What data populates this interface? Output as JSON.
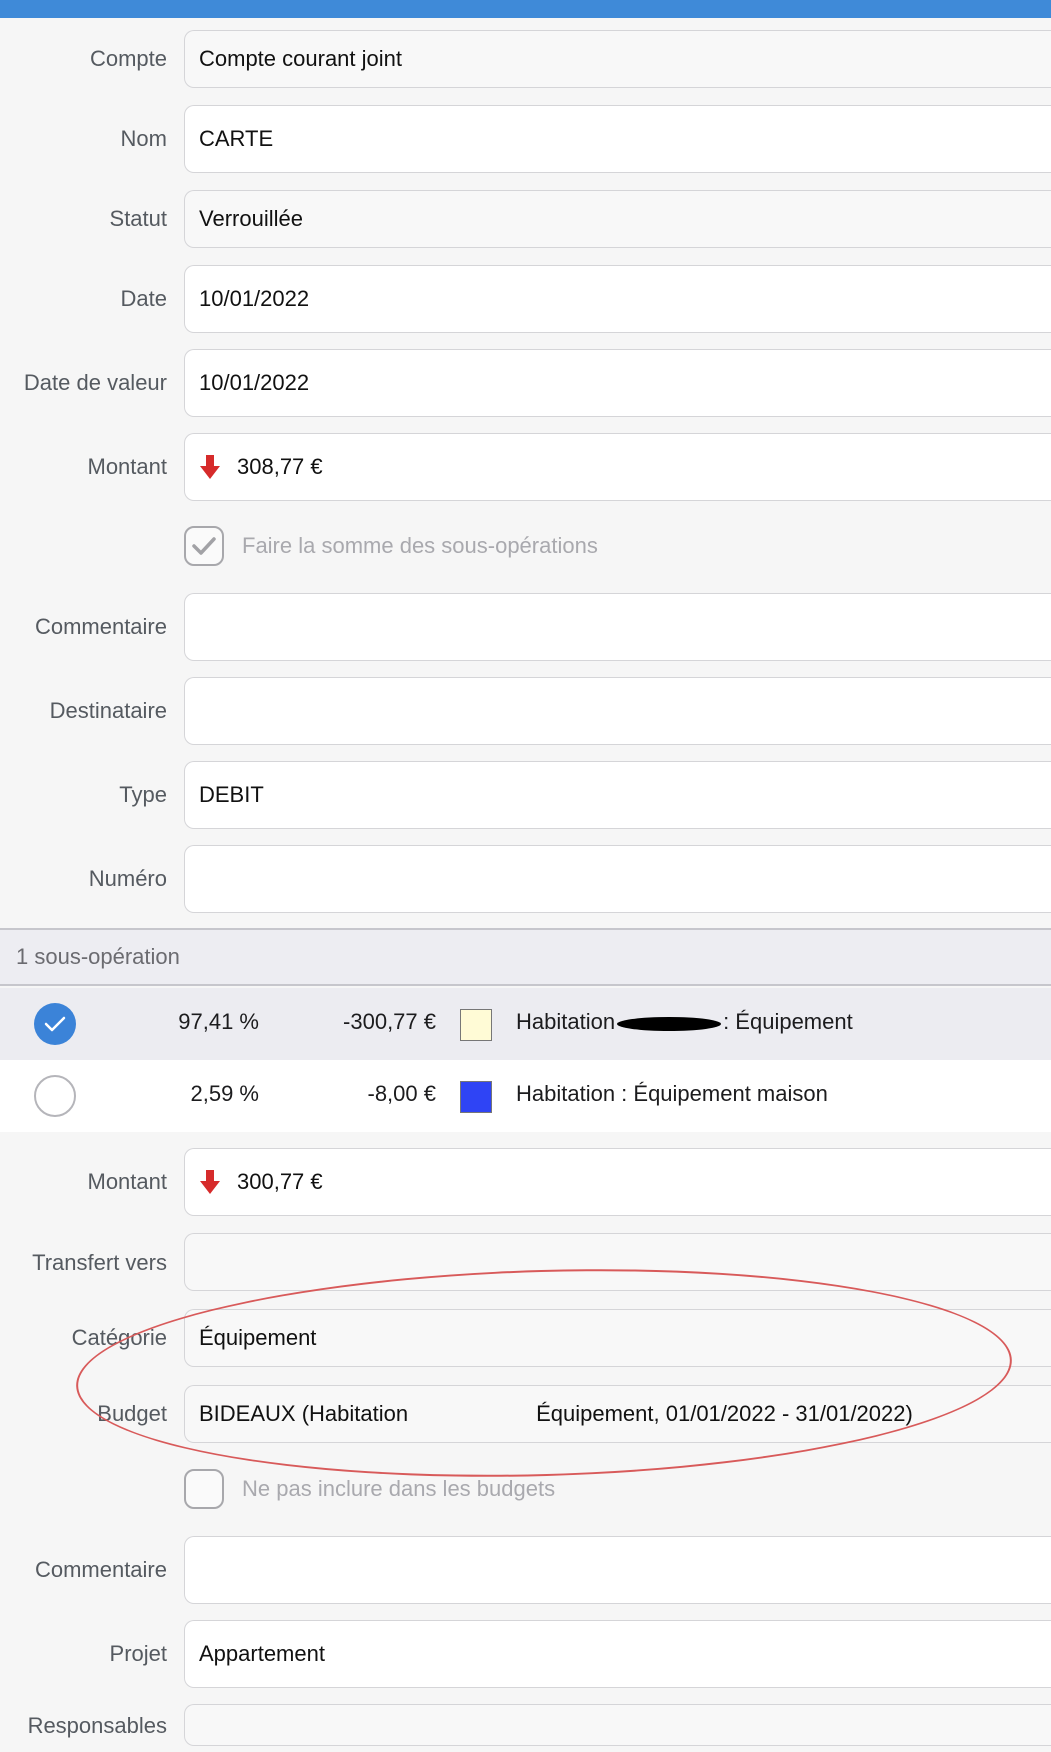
{
  "operation": {
    "compte": {
      "label": "Compte",
      "value": "Compte courant joint"
    },
    "nom": {
      "label": "Nom",
      "value": "CARTE"
    },
    "statut": {
      "label": "Statut",
      "value": "Verrouillée"
    },
    "date": {
      "label": "Date",
      "value": "10/01/2022"
    },
    "date_valeur": {
      "label": "Date de valeur",
      "value": "10/01/2022"
    },
    "montant": {
      "label": "Montant",
      "value": "308,77 €",
      "direction": "debit"
    },
    "somme_sous_operations": {
      "label": "Faire la somme des sous-opérations",
      "checked": true
    },
    "commentaire": {
      "label": "Commentaire",
      "value": ""
    },
    "destinataire": {
      "label": "Destinataire",
      "value": ""
    },
    "type": {
      "label": "Type",
      "value": "DEBIT"
    },
    "numero": {
      "label": "Numéro",
      "value": ""
    }
  },
  "sous_operations": {
    "header": "1 sous-opération",
    "items": [
      {
        "selected": true,
        "percent": "97,41 %",
        "amount": "-300,77 €",
        "color": "#fffbd6",
        "category_prefix": "Habitation",
        "category_suffix": ": Équipement"
      },
      {
        "selected": false,
        "percent": "2,59 %",
        "amount": "-8,00 €",
        "color": "#2f44f5",
        "category": "Habitation : Équipement maison"
      }
    ]
  },
  "detail": {
    "montant": {
      "label": "Montant",
      "value": "300,77 €",
      "direction": "debit"
    },
    "transfert": {
      "label": "Transfert vers",
      "value": ""
    },
    "categorie": {
      "label": "Catégorie",
      "value": "Équipement"
    },
    "budget": {
      "label": "Budget",
      "value_start": "BIDEAUX (Habitation",
      "value_end": "Équipement, 01/01/2022 - 31/01/2022)"
    },
    "exclure_budgets": {
      "label": "Ne pas inclure dans les budgets",
      "checked": false
    },
    "commentaire": {
      "label": "Commentaire",
      "value": ""
    },
    "projet": {
      "label": "Projet",
      "value": "Appartement"
    },
    "responsables": {
      "label": "Responsables",
      "value": ""
    }
  },
  "colors": {
    "accent": "#3f8ad8",
    "debit_arrow": "#d62b2b",
    "annotation": "#d85a5a"
  }
}
